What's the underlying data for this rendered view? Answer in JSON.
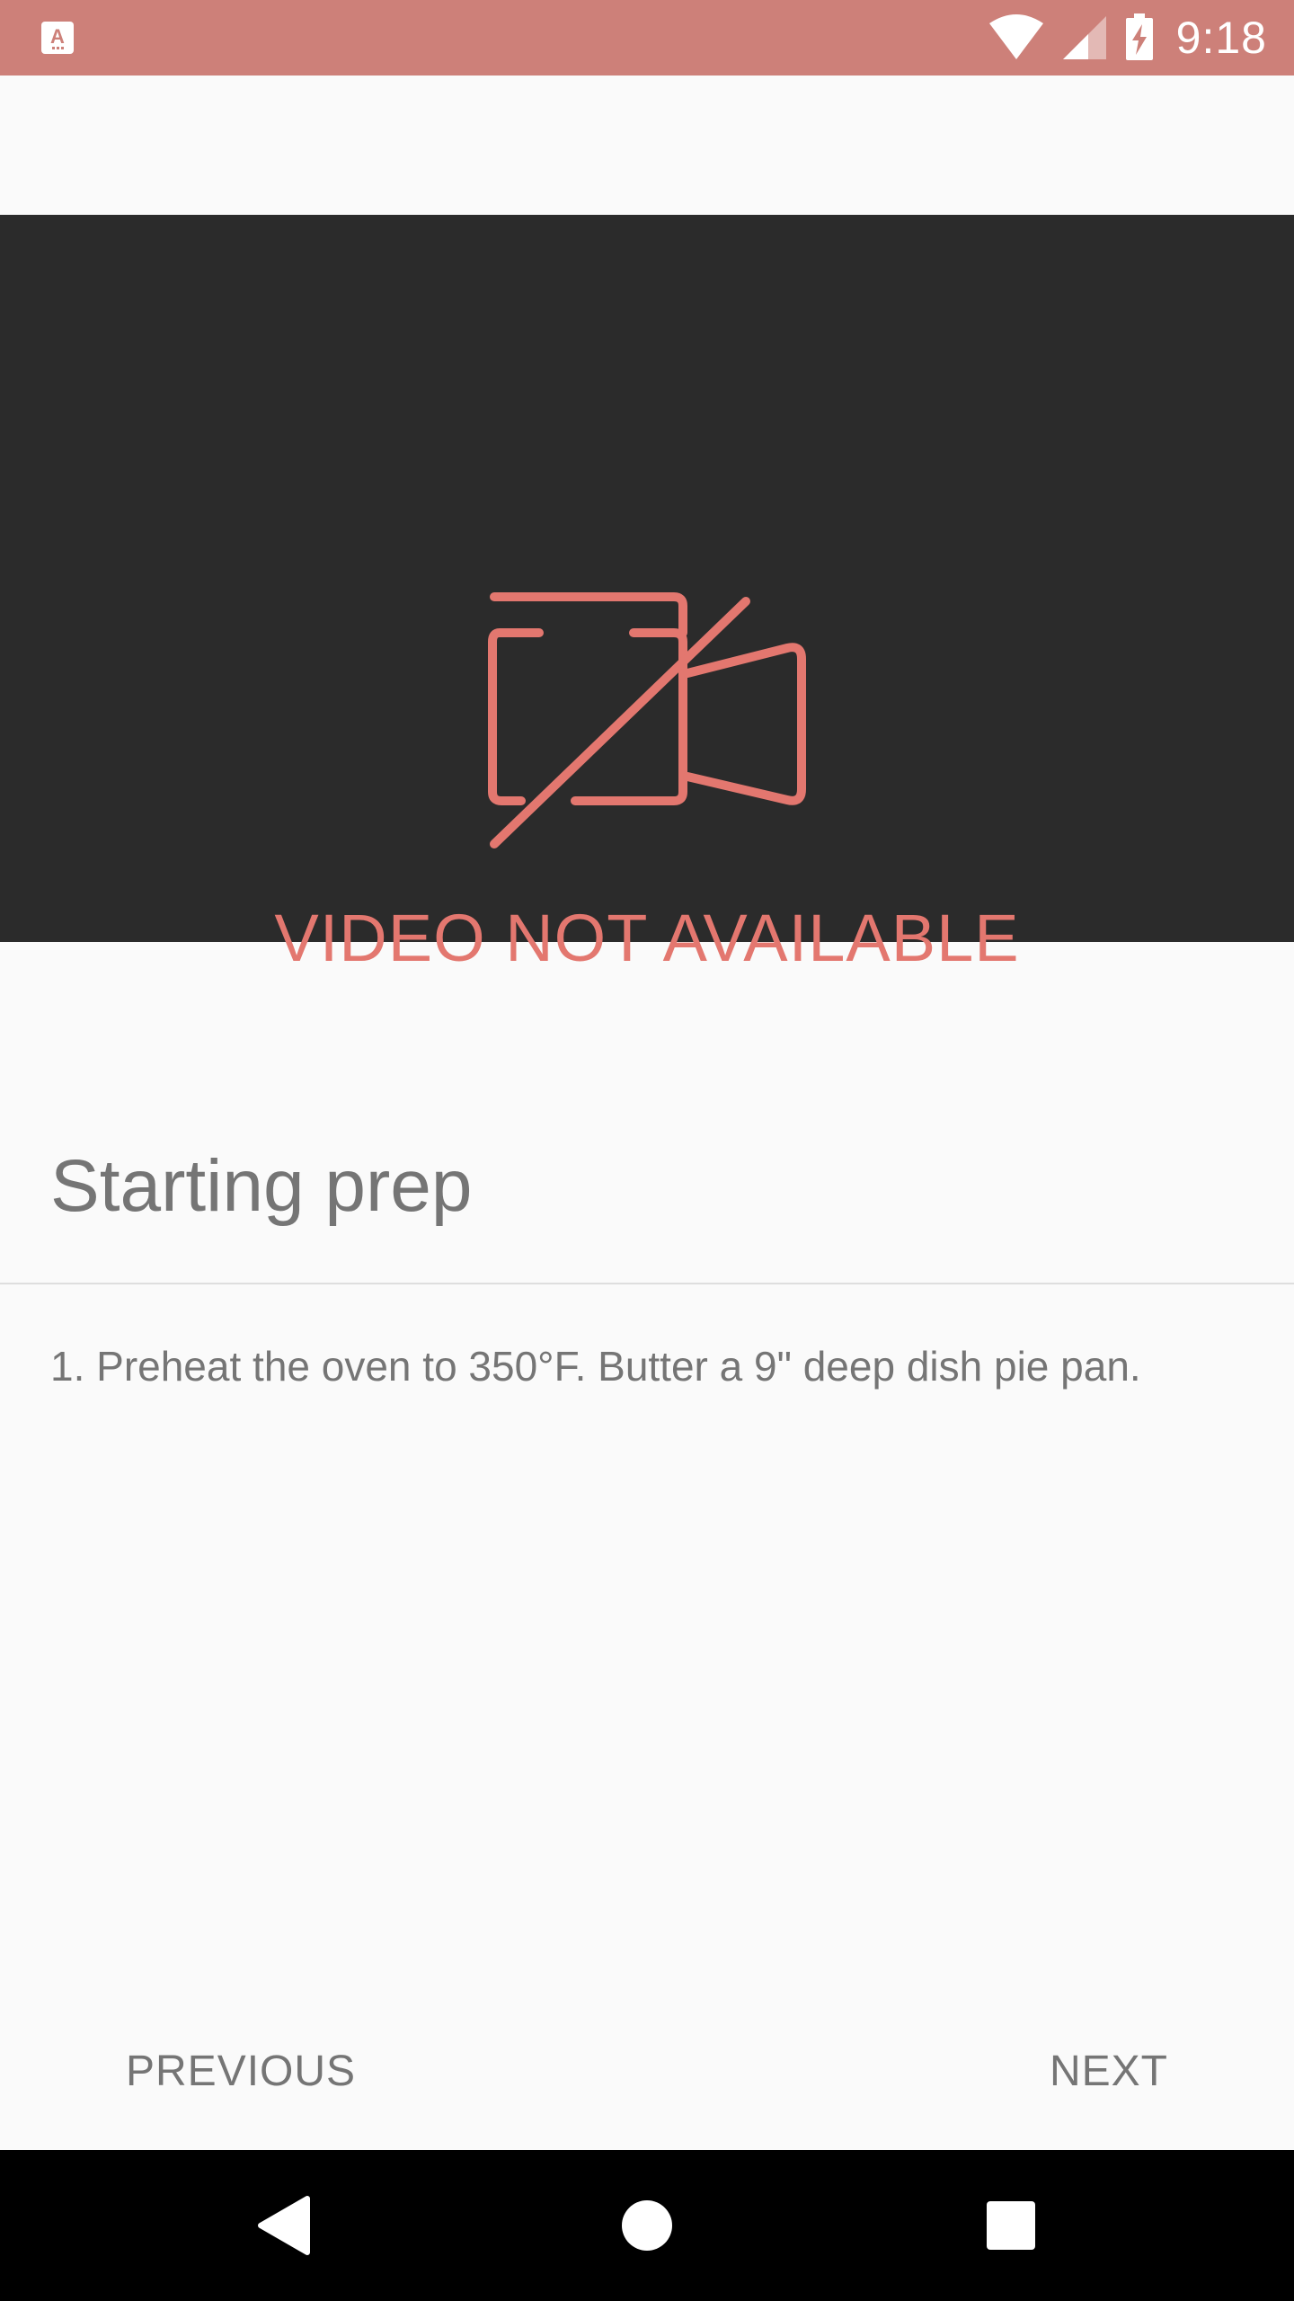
{
  "status_bar": {
    "time": "9:18",
    "color": "#cd8079",
    "icons": [
      "app-notification-icon",
      "wifi-icon",
      "cellular-signal-icon",
      "battery-charging-icon"
    ]
  },
  "video": {
    "message": "VIDEO NOT AVAILABLE",
    "icon": "video-off-icon",
    "accent_color": "#e3776f",
    "background_color": "#2b2b2b"
  },
  "step": {
    "title": "Starting prep",
    "description": "1. Preheat the oven to 350°F. Butter a 9\" deep dish pie pan."
  },
  "navigation": {
    "previous_label": "PREVIOUS",
    "next_label": "NEXT"
  },
  "system_nav": {
    "icons": [
      "back-icon",
      "home-icon",
      "recents-icon"
    ]
  }
}
